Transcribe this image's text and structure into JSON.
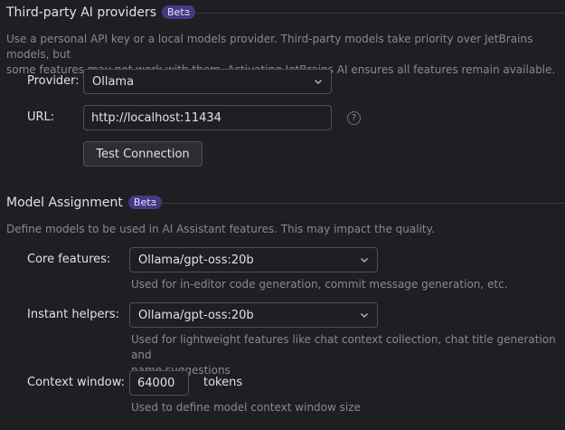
{
  "third_party": {
    "title": "Third-party AI providers",
    "badge": "Beta",
    "description_line1": "Use a personal API key or a local models provider. Third-party models take priority over JetBrains models, but",
    "description_line2": "some features may not work with them. Activating JetBrains AI ensures all features remain available.",
    "provider_label": "Provider:",
    "provider_value": "Ollama",
    "url_label": "URL:",
    "url_value": "http://localhost:11434",
    "help_glyph": "?",
    "test_button": "Test Connection"
  },
  "model_assignment": {
    "title": "Model Assignment",
    "badge": "Beta",
    "description": "Define models to be used in AI Assistant features. This may impact the quality.",
    "core_label": "Core features:",
    "core_value": "Ollama/gpt-oss:20b",
    "core_hint": "Used for in-editor code generation, commit message generation, etc.",
    "instant_label": "Instant helpers:",
    "instant_value": "Ollama/gpt-oss:20b",
    "instant_hint_line1": "Used for lightweight features like chat context collection, chat title generation and",
    "instant_hint_line2": "name suggestions",
    "context_label": "Context window:",
    "context_value": "64000",
    "context_unit": "tokens",
    "context_hint": "Used to define model context window size"
  },
  "icons": {
    "dropdown": "chevron-down-icon",
    "help": "question-circle-icon"
  },
  "colors": {
    "background": "#1e1f22",
    "beta_badge": "#453a84",
    "border": "#4e5157",
    "text": "#dfe1e5",
    "muted_text": "#868a91"
  }
}
